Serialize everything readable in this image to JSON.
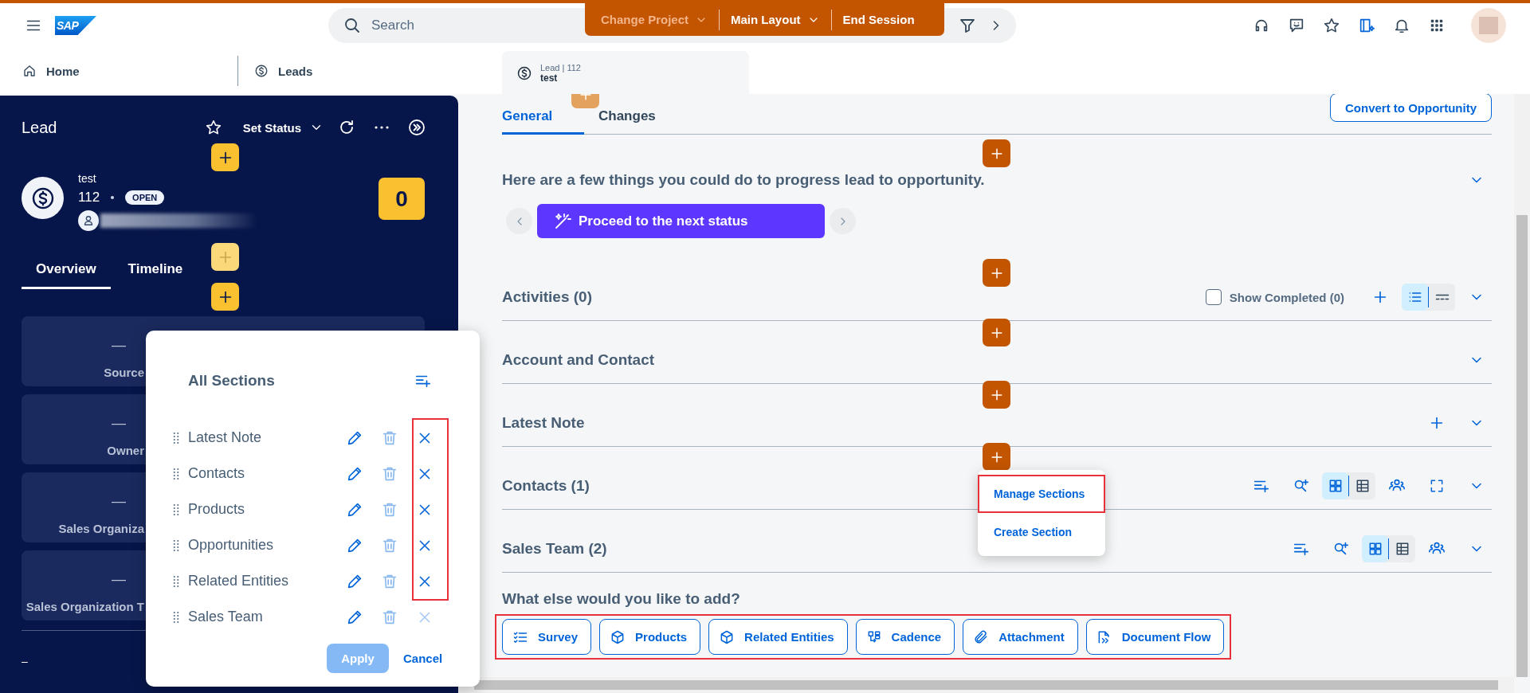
{
  "shell": {
    "brand": "SAP",
    "search_placeholder": "Search",
    "session_buttons": [
      {
        "label": "Change Project",
        "kind": "dropdown",
        "disabled": true
      },
      {
        "label": "Main Layout",
        "kind": "dropdown",
        "disabled": false
      },
      {
        "label": "End Session",
        "kind": "plain",
        "disabled": false
      }
    ]
  },
  "tabs": [
    {
      "kind": "home",
      "label": "Home",
      "selected": false
    },
    {
      "kind": "dollar",
      "label": "Leads",
      "selected": false
    },
    {
      "kind": "record",
      "overline": "Lead | 112",
      "label": "test",
      "selected": true
    }
  ],
  "lead_panel": {
    "title": "Lead",
    "set_status": "Set Status",
    "name": "test",
    "id": "112",
    "status": "OPEN",
    "score": "0",
    "tabs": [
      {
        "label": "Overview",
        "selected": true
      },
      {
        "label": "Timeline",
        "selected": false
      }
    ],
    "cards": [
      {
        "value": "—",
        "label": "Source"
      },
      {
        "value": "—",
        "label": "Owner"
      },
      {
        "value": "—",
        "label": "Sales Organiza"
      },
      {
        "value": "—",
        "label": "Sales Organization T"
      }
    ],
    "footer": "–"
  },
  "left_add_buttons": [
    {
      "disabled": false
    },
    {
      "disabled": true
    },
    {
      "disabled": false
    }
  ],
  "section_add_buttons": [
    {
      "disabled": true
    },
    {
      "disabled": false
    },
    {
      "disabled": false
    },
    {
      "disabled": false
    },
    {
      "disabled": false
    },
    {
      "disabled": false
    }
  ],
  "detail": {
    "tabs": [
      {
        "label": "General",
        "selected": true
      },
      {
        "label": "Changes",
        "selected": false
      }
    ],
    "primary_action": "Convert to Opportunity",
    "sections": [
      {
        "kind": "guidance",
        "title": "Here are a few things you could do to progress lead to opportunity.",
        "action": "Proceed to the next status"
      },
      {
        "kind": "activities",
        "title": "Activities (0)",
        "show_completed": {
          "label": "Show Completed (0)",
          "checked": false
        },
        "view_options": [
          {
            "kind": "list",
            "selected": true
          },
          {
            "kind": "timeline",
            "selected": false
          }
        ]
      },
      {
        "kind": "plain",
        "title": "Account and Contact"
      },
      {
        "kind": "note",
        "title": "Latest Note"
      },
      {
        "kind": "table",
        "title": "Contacts (1)",
        "view_options": [
          {
            "kind": "grid",
            "selected": true
          },
          {
            "kind": "table",
            "selected": false
          }
        ],
        "fullscreen": true
      },
      {
        "kind": "table",
        "title": "Sales Team (2)",
        "view_options": [
          {
            "kind": "grid",
            "selected": true
          },
          {
            "kind": "table",
            "selected": false
          }
        ],
        "fullscreen": false
      }
    ],
    "add_prompt": "What else would you like to add?",
    "add_chips_annotated": true,
    "add_chips": [
      {
        "kind": "survey",
        "label": "Survey"
      },
      {
        "kind": "cube",
        "label": "Products"
      },
      {
        "kind": "cube",
        "label": "Related Entities"
      },
      {
        "kind": "cadence",
        "label": "Cadence"
      },
      {
        "kind": "attachment",
        "label": "Attachment"
      },
      {
        "kind": "docflow",
        "label": "Document Flow"
      }
    ]
  },
  "section_menu": {
    "items": [
      {
        "label": "Manage Sections",
        "annotated": true
      },
      {
        "label": "Create Section",
        "annotated": false
      }
    ]
  },
  "manage_dialog": {
    "title": "All Sections",
    "remove_column_annotated": true,
    "rows": [
      {
        "label": "Latest Note",
        "removable": true
      },
      {
        "label": "Contacts",
        "removable": true
      },
      {
        "label": "Products",
        "removable": true
      },
      {
        "label": "Opportunities",
        "removable": true
      },
      {
        "label": "Related Entities",
        "removable": true
      },
      {
        "label": "Sales Team",
        "removable": false
      }
    ],
    "apply": {
      "label": "Apply",
      "disabled": true
    },
    "cancel": "Cancel"
  }
}
